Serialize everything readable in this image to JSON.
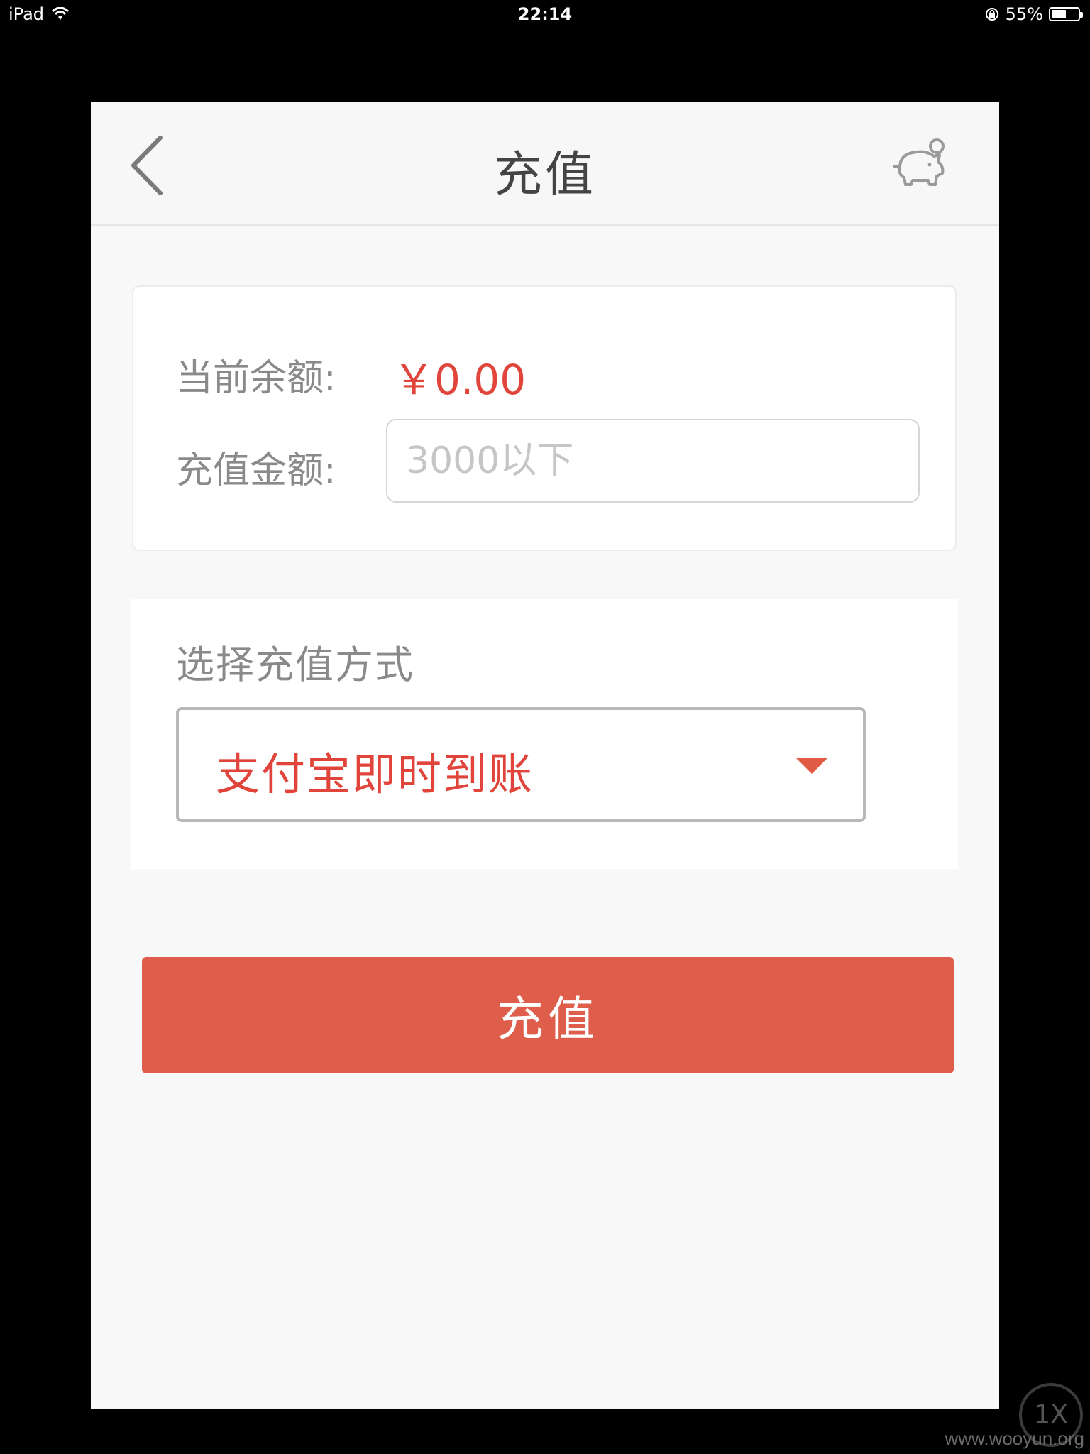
{
  "status_bar": {
    "device": "iPad",
    "time": "22:14",
    "battery": "55%",
    "battery_level": 0.55,
    "icons": [
      "wifi-icon",
      "rotation-lock-icon",
      "battery-icon"
    ]
  },
  "navbar": {
    "title": "充值",
    "back_icon": "chevron-left-icon",
    "right_icon": "piggy-bank-icon"
  },
  "balance": {
    "label": "当前余额:",
    "value": "￥0.00"
  },
  "amount": {
    "label": "充值金额:",
    "placeholder": "3000以下",
    "value": ""
  },
  "payment_method": {
    "title": "选择充值方式",
    "selected": "支付宝即时到账",
    "caret_icon": "caret-down-icon"
  },
  "submit": {
    "label": "充值"
  },
  "overlay": {
    "zoom_badge": "1X",
    "watermark": "www.wooyun.org"
  },
  "colors": {
    "accent_red": "#e0443a",
    "button_red": "#de5e4b",
    "muted_text": "#8a8a8a",
    "background": "#f8f8f8"
  }
}
